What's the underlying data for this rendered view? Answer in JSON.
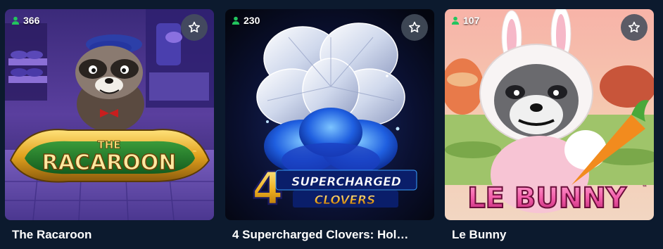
{
  "games": [
    {
      "title": "The Racaroon",
      "players": "366",
      "logo_top": "THE",
      "logo_main": "RACAROON",
      "player_icon": "user-icon",
      "favorite_icon": "star-icon"
    },
    {
      "title": "4 Supercharged Clovers: Hol…",
      "players": "230",
      "logo_number": "4",
      "logo_line1": "SUPERCHARGED",
      "logo_line2": "CLOVERS",
      "player_icon": "user-icon",
      "favorite_icon": "star-icon"
    },
    {
      "title": "Le Bunny",
      "players": "107",
      "logo_main": "LE BUNNY",
      "player_icon": "user-icon",
      "favorite_icon": "star-icon"
    }
  ],
  "colors": {
    "background": "#0c1a2e",
    "player_icon": "#22c55e",
    "fav_button": "#464e5c",
    "title_text": "#ffffff"
  }
}
